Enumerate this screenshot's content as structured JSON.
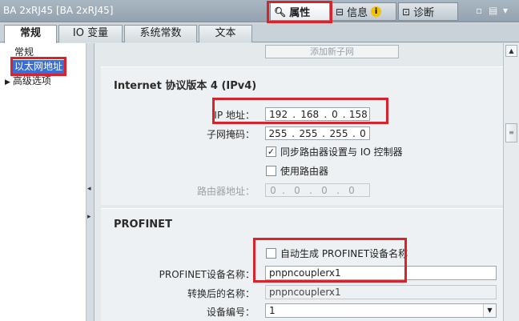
{
  "window": {
    "title": "BA 2xRJ45 [BA 2xRJ45]"
  },
  "top_tabs": [
    {
      "label": "属性",
      "icon": "magnifier-properties-icon",
      "active": true
    },
    {
      "label": "信息",
      "icon": "info-icon",
      "badge": "i"
    },
    {
      "label": "诊断",
      "icon": "diagnostics-icon"
    }
  ],
  "window_controls": {
    "restore": "▫",
    "menu": "▤",
    "expand": "▾"
  },
  "section_tabs": [
    {
      "label": "常规",
      "active": true
    },
    {
      "label": "IO 变量"
    },
    {
      "label": "系统常数"
    },
    {
      "label": "文本"
    }
  ],
  "nav": {
    "items": [
      {
        "label": "常规"
      },
      {
        "label": "以太网地址",
        "selected": true
      },
      {
        "label": "高级选项",
        "expandable": true,
        "arrow": "▶"
      }
    ]
  },
  "splitter": {
    "collapse_arrow": "◂",
    "expand_arrow": "▸"
  },
  "add_subnet_button": "添加新子网",
  "ipv4": {
    "title": "Internet 协议版本 4 (IPv4)",
    "ip_label": "IP 地址：",
    "ip": [
      "192",
      "168",
      "0",
      "158"
    ],
    "mask_label": "子网掩码：",
    "mask": [
      "255",
      "255",
      "255",
      "0"
    ],
    "sync_router": {
      "label": "同步路由器设置与 IO 控制器",
      "checked": true,
      "mark": "✓"
    },
    "use_router": {
      "label": "使用路由器",
      "checked": false
    },
    "router_label": "路由器地址：",
    "router": [
      "0",
      "0",
      "0",
      "0"
    ]
  },
  "profinet": {
    "title": "PROFINET",
    "auto_generate": {
      "label": "自动生成 PROFINET设备名称",
      "checked": false
    },
    "device_name_label": "PROFINET设备名称：",
    "device_name": "pnpncouplerx1",
    "converted_label": "转换后的名称：",
    "converted_name": "pnpncouplerx1",
    "device_number_label": "设备编号：",
    "device_number": "1",
    "dropdown_arrow": "▼"
  },
  "scrollbar": {
    "up": "▲",
    "thumb": "≡"
  },
  "colors": {
    "highlight": "#d9222a",
    "selection": "#3a6fd8"
  }
}
